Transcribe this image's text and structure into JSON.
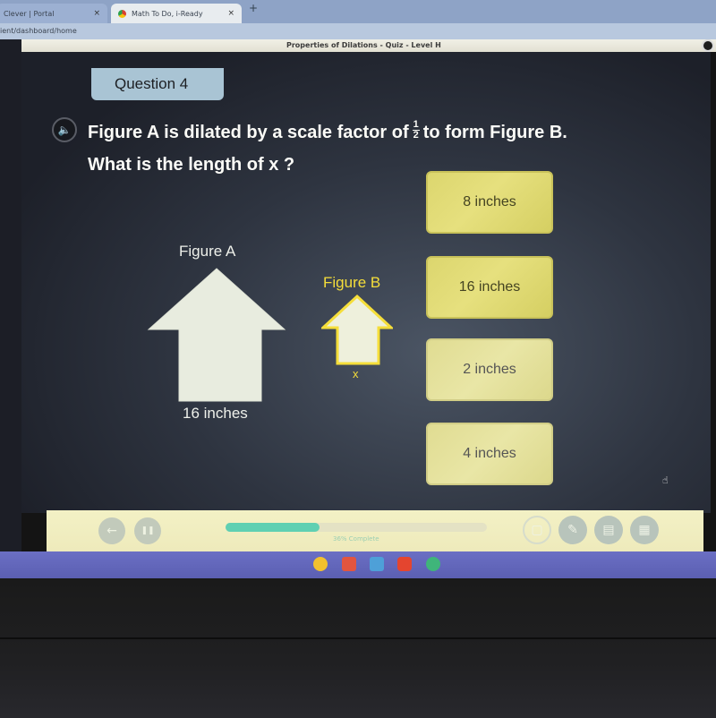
{
  "browser": {
    "tabs": [
      {
        "label": "Clever | Portal",
        "close": "×"
      },
      {
        "label": "Math To Do, i-Ready",
        "close": "×"
      }
    ],
    "new_tab": "+",
    "address": "ient/dashboard/home"
  },
  "app": {
    "title": "Properties of Dilations - Quiz - Level H"
  },
  "question": {
    "badge": "Question 4",
    "speaker_icon": "speaker-icon",
    "text_before": "Figure A is dilated by a scale factor of",
    "fraction": {
      "numerator": "1",
      "denominator": "2"
    },
    "text_after": "to form Figure B.",
    "line2": "What is the length of x ?"
  },
  "figures": {
    "a": {
      "label": "Figure A",
      "dimension": "16 inches",
      "color": "#e8ecdf"
    },
    "b": {
      "label": "Figure B",
      "dimension": "x",
      "color": "#f5de3a"
    },
    "scale_factor": 0.5
  },
  "answers": [
    {
      "label": "8 inches"
    },
    {
      "label": "16 inches"
    },
    {
      "label": "2 inches"
    },
    {
      "label": "4 inches"
    }
  ],
  "toolbar": {
    "back_icon": "←",
    "pause_icon": "❚❚",
    "progress_percent": 36,
    "progress_text": "36% Complete",
    "tools": [
      {
        "name": "scratchpad",
        "glyph": "▢"
      },
      {
        "name": "pencil",
        "glyph": "✎"
      },
      {
        "name": "notepad",
        "glyph": "▤"
      },
      {
        "name": "calculator",
        "glyph": "▦"
      }
    ]
  },
  "shelf": {
    "apps": [
      {
        "name": "chrome",
        "color": "#f2c12e"
      },
      {
        "name": "gmail",
        "color": "#e2553f"
      },
      {
        "name": "files",
        "color": "#4ea0d8"
      },
      {
        "name": "youtube",
        "color": "#e4452f"
      },
      {
        "name": "play-store",
        "color": "#3fb57a"
      }
    ]
  },
  "colors": {
    "answer_bg": "#e0da72",
    "progress": "#5fd0b2",
    "figure_b": "#f5de3a"
  }
}
